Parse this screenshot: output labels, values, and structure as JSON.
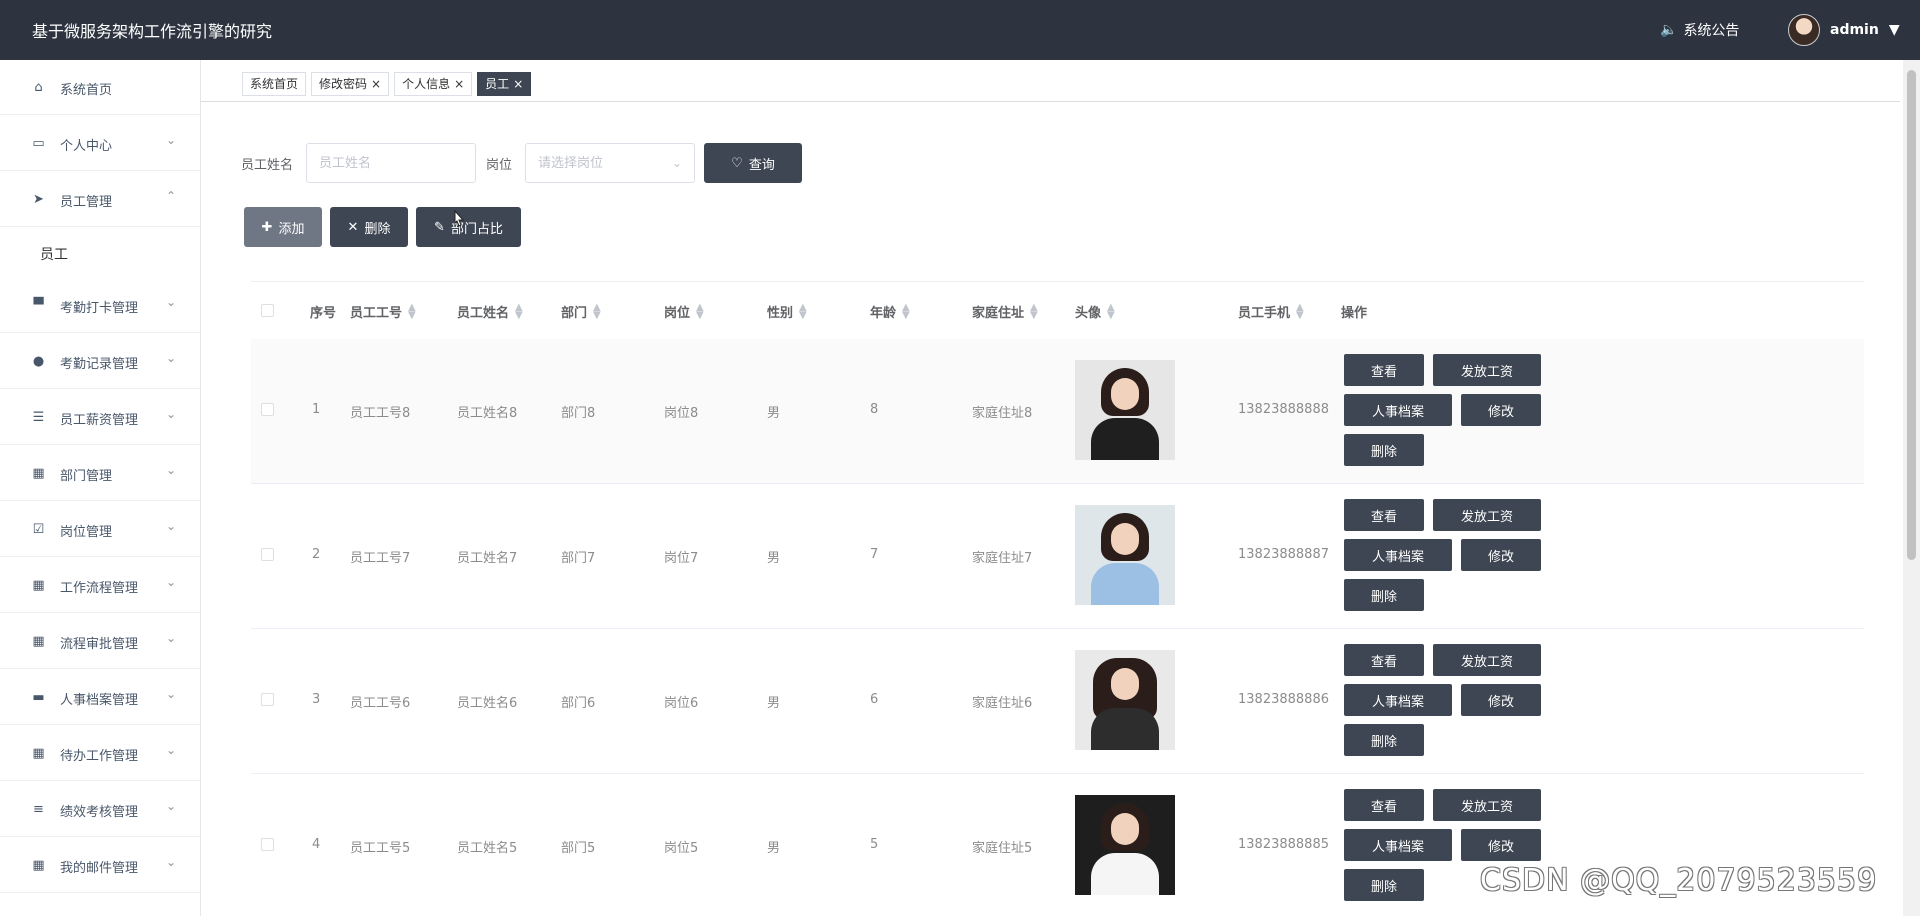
{
  "app": {
    "title": "基于微服务架构工作流引擎的研究",
    "notice_label": "系统公告",
    "username": "admin"
  },
  "sidebar": {
    "items": [
      {
        "label": "系统首页",
        "icon": "home-icon"
      },
      {
        "label": "个人中心",
        "icon": "card-icon"
      },
      {
        "label": "员工管理",
        "icon": "send-icon"
      },
      {
        "label": "考勤打卡管理",
        "icon": "monitor-icon"
      },
      {
        "label": "考勤记录管理",
        "icon": "pin-icon"
      },
      {
        "label": "员工薪资管理",
        "icon": "list-icon"
      },
      {
        "label": "部门管理",
        "icon": "grid-icon"
      },
      {
        "label": "岗位管理",
        "icon": "clipboard-icon"
      },
      {
        "label": "工作流程管理",
        "icon": "grid-icon"
      },
      {
        "label": "流程审批管理",
        "icon": "grid-icon"
      },
      {
        "label": "人事档案管理",
        "icon": "laptop-icon"
      },
      {
        "label": "待办工作管理",
        "icon": "grid-icon"
      },
      {
        "label": "绩效考核管理",
        "icon": "sliders-icon"
      },
      {
        "label": "我的邮件管理",
        "icon": "grid-icon"
      }
    ],
    "subitem": "员工"
  },
  "tabs": [
    {
      "label": "系统首页",
      "closable": false
    },
    {
      "label": "修改密码",
      "closable": true
    },
    {
      "label": "个人信息",
      "closable": true
    },
    {
      "label": "员工",
      "closable": true
    }
  ],
  "filters": {
    "name_label": "员工姓名",
    "name_placeholder": "员工姓名",
    "post_label": "岗位",
    "post_placeholder": "请选择岗位",
    "query_button": "查询"
  },
  "actions": {
    "add": "添加",
    "delete": "删除",
    "dept_ratio": "部门占比"
  },
  "table": {
    "headers": [
      "序号",
      "员工工号",
      "员工姓名",
      "部门",
      "岗位",
      "性别",
      "年龄",
      "家庭住址",
      "头像",
      "员工手机",
      "操作"
    ],
    "rows": [
      {
        "index": "1",
        "emp_no": "员工工号8",
        "name": "员工姓名8",
        "dept": "部门8",
        "post": "岗位8",
        "gender": "男",
        "age": "8",
        "address": "家庭住址8",
        "phone": "13823888888",
        "photo": "woman-black-blazer"
      },
      {
        "index": "2",
        "emp_no": "员工工号7",
        "name": "员工姓名7",
        "dept": "部门7",
        "post": "岗位7",
        "gender": "男",
        "age": "7",
        "address": "家庭住址7",
        "phone": "13823888887",
        "photo": "woman-blue-shirt"
      },
      {
        "index": "3",
        "emp_no": "员工工号6",
        "name": "员工姓名6",
        "dept": "部门6",
        "post": "岗位6",
        "gender": "男",
        "age": "6",
        "address": "家庭住址6",
        "phone": "13823888886",
        "photo": "woman-dark-hair"
      },
      {
        "index": "4",
        "emp_no": "员工工号5",
        "name": "员工姓名5",
        "dept": "部门5",
        "post": "岗位5",
        "gender": "男",
        "age": "5",
        "address": "家庭住址5",
        "phone": "13823888885",
        "photo": "woman-white-blazer"
      }
    ],
    "operations": {
      "view": "查看",
      "salary": "发放工资",
      "archive": "人事档案",
      "edit": "修改",
      "delete": "删除"
    }
  },
  "watermark": "CSDN @QQ_2079523559",
  "colors": {
    "topbar": "#2d3440",
    "button": "#3d4652",
    "button_disabled": "#6e7783"
  }
}
